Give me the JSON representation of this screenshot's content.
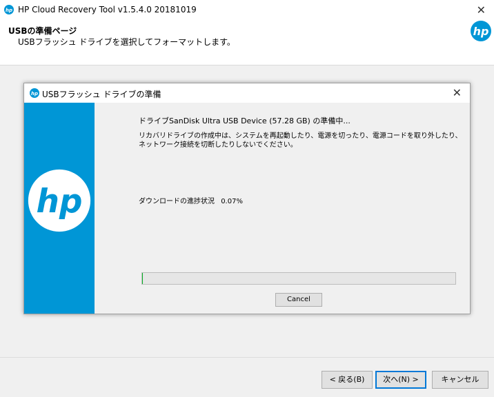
{
  "window": {
    "title": "HP Cloud Recovery Tool v1.5.4.0 20181019",
    "close_glyph": "✕",
    "icon": "hp-logo-icon"
  },
  "header": {
    "title": "USBの準備ページ",
    "subtitle": "USBフラッシュ ドライブを選択してフォーマットします。",
    "logo": "hp-logo-icon"
  },
  "dialog": {
    "title": "USBフラッシュ ドライブの準備",
    "close_glyph": "✕",
    "status_line": "ドライブSanDisk Ultra USB Device (57.28 GB) の準備中...",
    "warning": "リカバリドライブの作成中は、システムを再起動したり、電源を切ったり、電源コードを取り外したり、ネットワーク接続を切断したりしないでください。",
    "progress_label": "ダウンロードの進捗状況",
    "progress_value": "0.07%",
    "progress_fraction": 0.0007,
    "cancel_label": "Cancel",
    "side_color": "#0096d6"
  },
  "footer": {
    "back_label": "< 戻る(B)",
    "next_label": "次へ(N) >",
    "cancel_label": "キャンセル"
  },
  "colors": {
    "hp_blue": "#0096d6",
    "focus_border": "#0078d7"
  }
}
